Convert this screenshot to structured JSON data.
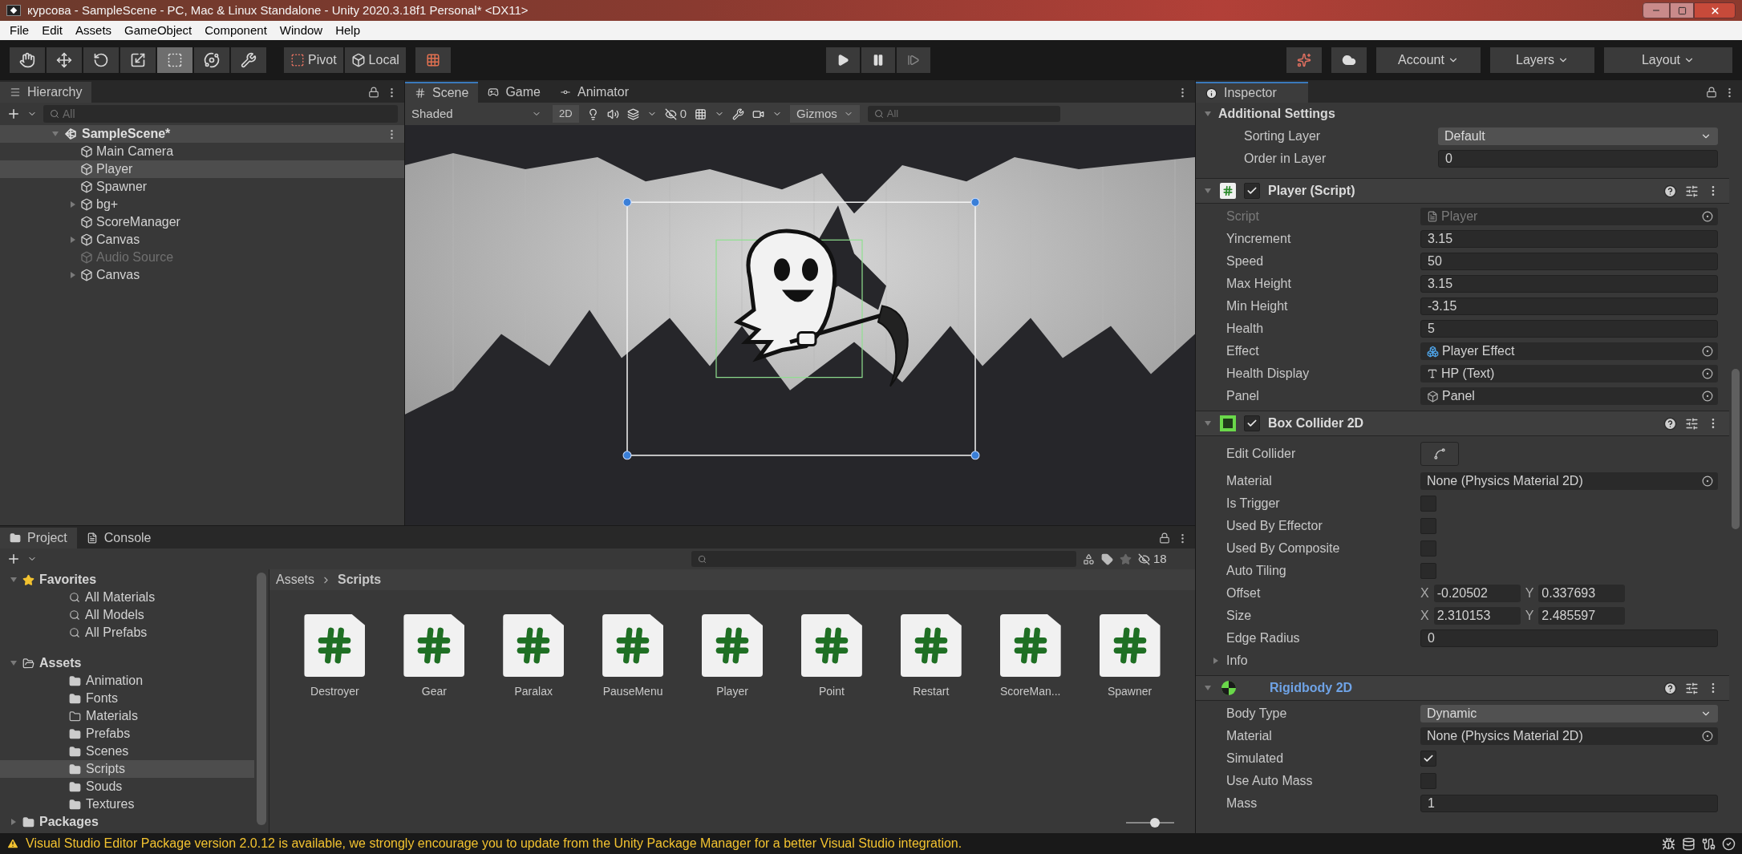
{
  "window": {
    "title": "курсова - SampleScene - PC, Mac & Linux Standalone - Unity 2020.3.18f1 Personal* <DX11>"
  },
  "menu": [
    "File",
    "Edit",
    "Assets",
    "GameObject",
    "Component",
    "Window",
    "Help"
  ],
  "toolbar": {
    "tools": [
      {
        "kind": "hand",
        "selected": false
      },
      {
        "kind": "move",
        "selected": false
      },
      {
        "kind": "rotate",
        "selected": false
      },
      {
        "kind": "scale",
        "selected": false
      },
      {
        "kind": "rect",
        "selected": true
      },
      {
        "kind": "transform",
        "selected": false
      },
      {
        "kind": "custom",
        "selected": false
      }
    ],
    "pivot": "Pivot",
    "local": "Local",
    "account": "Account",
    "layers": "Layers",
    "layout": "Layout"
  },
  "hierarchy": {
    "title": "Hierarchy",
    "search_placeholder": "All",
    "scene": "SampleScene*",
    "items": [
      {
        "name": "Main Camera",
        "kind": "leaf",
        "selected": false,
        "disabled": false
      },
      {
        "name": "Player",
        "kind": "leaf",
        "selected": true,
        "disabled": false
      },
      {
        "name": "Spawner",
        "kind": "leaf",
        "selected": false,
        "disabled": false
      },
      {
        "name": "bg+",
        "kind": "group",
        "selected": false,
        "disabled": false
      },
      {
        "name": "ScoreManager",
        "kind": "leaf",
        "selected": false,
        "disabled": false
      },
      {
        "name": "Canvas",
        "kind": "group",
        "selected": false,
        "disabled": false
      },
      {
        "name": "Audio Source",
        "kind": "leaf",
        "selected": false,
        "disabled": true
      },
      {
        "name": "Canvas",
        "kind": "group",
        "selected": false,
        "disabled": false
      }
    ]
  },
  "scene_view": {
    "tabs": [
      {
        "label": "Scene",
        "kind": "scene",
        "selected": true
      },
      {
        "label": "Game",
        "kind": "game",
        "selected": false
      },
      {
        "label": "Animator",
        "kind": "animator",
        "selected": false
      }
    ],
    "shading": "Shaded",
    "mode_2d": "2D",
    "hidden_count": "0",
    "gizmos": "Gizmos",
    "search_placeholder": "All"
  },
  "inspector": {
    "title": "Inspector",
    "settings": {
      "title": "Additional Settings",
      "expanded": true,
      "rows": [
        {
          "label": "Sorting Layer",
          "kind": "dropdown",
          "value": "Default"
        },
        {
          "label": "Order in Layer",
          "kind": "field",
          "value": "0"
        }
      ]
    },
    "components": [
      {
        "title": "Player (Script)",
        "kind": "script",
        "enabled": true,
        "expanded": true,
        "overridden": false,
        "rows": [
          {
            "label": "Script",
            "kind": "script-ref",
            "value": "Player",
            "disabled": true
          },
          {
            "label": "Yincrement",
            "kind": "field",
            "value": "3.15",
            "disabled": false
          },
          {
            "label": "Speed",
            "kind": "field",
            "value": "50",
            "disabled": false
          },
          {
            "label": "Max Height",
            "kind": "field",
            "value": "3.15",
            "disabled": false
          },
          {
            "label": "Min Height",
            "kind": "field",
            "value": "-3.15",
            "disabled": false
          },
          {
            "label": "Health",
            "kind": "field",
            "value": "5",
            "disabled": false
          },
          {
            "label": "Effect",
            "kind": "prefab-ref",
            "value": "Player Effect",
            "disabled": false
          },
          {
            "label": "Health Display",
            "kind": "text-ref",
            "value": "HP (Text)",
            "disabled": false
          },
          {
            "label": "Panel",
            "kind": "object-ref",
            "value": "Panel",
            "disabled": false
          }
        ]
      },
      {
        "title": "Box Collider 2D",
        "kind": "collider",
        "enabled": true,
        "expanded": true,
        "overridden": false,
        "rows": [
          {
            "label": "Edit Collider",
            "kind": "button"
          },
          {
            "label": "Material",
            "kind": "asset-ref",
            "value": "None (Physics Material 2D)"
          },
          {
            "label": "Is Trigger",
            "kind": "checkbox",
            "checked": false
          },
          {
            "label": "Used By Effector",
            "kind": "checkbox",
            "checked": false
          },
          {
            "label": "Used By Composite",
            "kind": "checkbox",
            "checked": false
          },
          {
            "label": "Auto Tiling",
            "kind": "checkbox",
            "checked": false
          },
          {
            "label": "Offset",
            "kind": "vector",
            "parts": [
              {
                "axis": "X",
                "value": "-0.20502"
              },
              {
                "axis": "Y",
                "value": "0.337693"
              }
            ]
          },
          {
            "label": "Size",
            "kind": "vector",
            "parts": [
              {
                "axis": "X",
                "value": "2.310153"
              },
              {
                "axis": "Y",
                "value": "2.485597"
              }
            ]
          },
          {
            "label": "Edge Radius",
            "kind": "field",
            "value": "0"
          },
          {
            "label": "Info",
            "kind": "foldout",
            "expanded": false
          }
        ]
      },
      {
        "title": "Rigidbody 2D",
        "kind": "rigidbody",
        "expanded": true,
        "overridden": true,
        "rows": [
          {
            "label": "Body Type",
            "kind": "dropdown",
            "value": "Dynamic"
          },
          {
            "label": "Material",
            "kind": "asset-ref",
            "value": "None (Physics Material 2D)"
          },
          {
            "label": "Simulated",
            "kind": "checkbox",
            "checked": true
          },
          {
            "label": "Use Auto Mass",
            "kind": "checkbox",
            "checked": false
          },
          {
            "label": "Mass",
            "kind": "field",
            "value": "1"
          }
        ]
      }
    ]
  },
  "project": {
    "tabs": [
      {
        "label": "Project",
        "kind": "project",
        "selected": true
      },
      {
        "label": "Console",
        "kind": "console",
        "selected": false
      }
    ],
    "hidden_count": "18",
    "tree": [
      {
        "label": "Favorites",
        "kind": "favorites",
        "expanded": true,
        "selected": false,
        "children": [
          {
            "label": "All Materials",
            "kind": "search",
            "selected": false
          },
          {
            "label": "All Models",
            "kind": "search",
            "selected": false
          },
          {
            "label": "All Prefabs",
            "kind": "search",
            "selected": false
          }
        ]
      },
      {
        "label": "Assets",
        "kind": "folder",
        "expanded": true,
        "selected": false,
        "children": [
          {
            "label": "Animation",
            "kind": "folder",
            "selected": false
          },
          {
            "label": "Fonts",
            "kind": "folder",
            "selected": false
          },
          {
            "label": "Materials",
            "kind": "empty-folder",
            "selected": false
          },
          {
            "label": "Prefabs",
            "kind": "folder",
            "selected": false
          },
          {
            "label": "Scenes",
            "kind": "folder",
            "selected": false
          },
          {
            "label": "Scripts",
            "kind": "folder",
            "selected": true
          },
          {
            "label": "Souds",
            "kind": "folder",
            "selected": false
          },
          {
            "label": "Textures",
            "kind": "folder",
            "selected": false
          }
        ]
      },
      {
        "label": "Packages",
        "kind": "folder",
        "expanded": false,
        "selected": false
      }
    ],
    "zoom_slider": {
      "level": 0.6
    },
    "breadcrumb": [
      "Assets",
      "Scripts"
    ],
    "files": [
      "Destroyer",
      "Gear",
      "Paralax",
      "PauseMenu",
      "Player",
      "Point",
      "Restart",
      "ScoreMan...",
      "Spawner"
    ]
  },
  "status_bar": {
    "message": "Visual Studio Editor Package version 2.0.12 is available, we strongly encourage you to update from the Unity Package Manager for a better Visual Studio integration."
  }
}
